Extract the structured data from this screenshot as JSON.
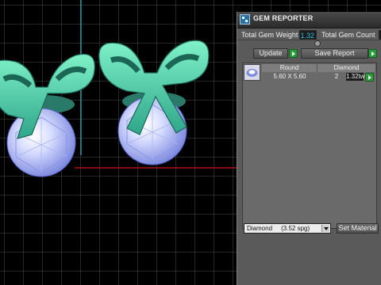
{
  "viewport": {
    "name": "3D jewelry viewport",
    "colors": {
      "background": "#000000",
      "grid": "#5f5f5f",
      "axis_x": "#b0101c",
      "axis_y": "#1f8fa0",
      "band": "#5fe0b0",
      "gem": "#9fb0ff"
    }
  },
  "panel": {
    "title": "GEM REPORTER",
    "total_weight_label": "Total Gem Weight",
    "total_weight_value": "1.32",
    "total_count_label": "Total Gem Count",
    "total_count_value": "",
    "update_label": "Update",
    "save_report_label": "Save Report",
    "table": {
      "headers": [
        "Round",
        "Diamond"
      ],
      "rows": [
        {
          "shape": "Round",
          "size": "5.60 X 5.60",
          "count": "2",
          "weight": "1.32tw"
        }
      ]
    },
    "material_select": "Diamond     (3.52 spg)",
    "set_material_label": "Set Material"
  }
}
